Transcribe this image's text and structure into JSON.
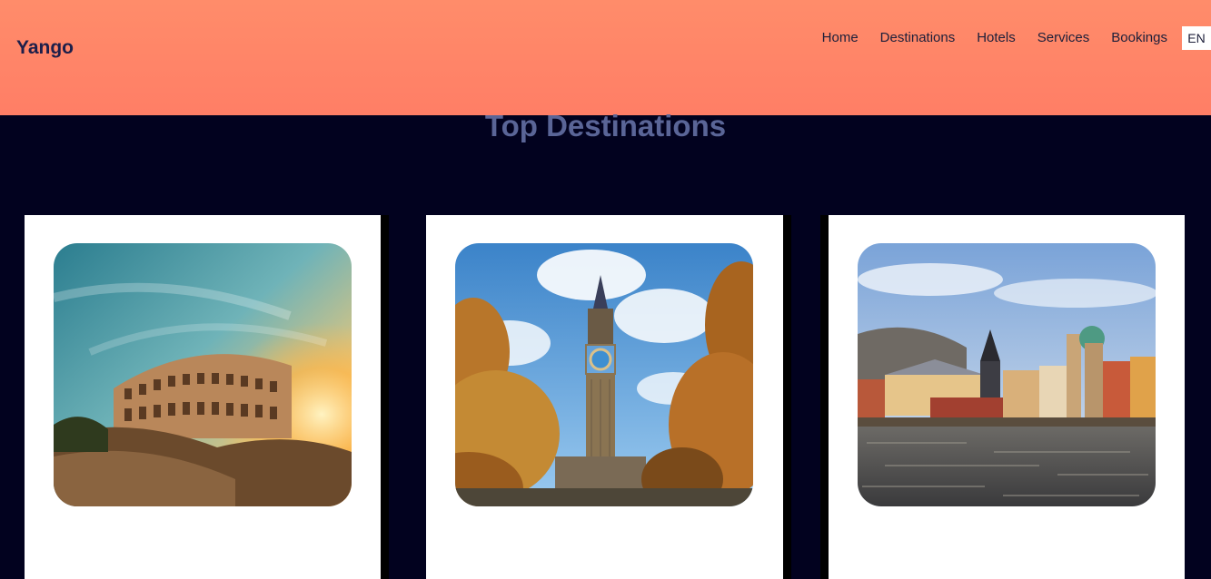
{
  "header": {
    "logo": "Yango",
    "nav": [
      "Home",
      "Destinations",
      "Hotels",
      "Services",
      "Bookings"
    ],
    "language": "EN"
  },
  "main": {
    "section_title": "Top Destinations",
    "cards": [
      {
        "image_icon": "colosseum-photo-icon"
      },
      {
        "image_icon": "big-ben-photo-icon"
      },
      {
        "image_icon": "prague-riverside-photo-icon"
      }
    ]
  },
  "colors": {
    "header_gradient_top": "#ff8c6a",
    "header_gradient_bottom": "#ff7e66",
    "page_background": "#02021f",
    "title_color": "#5a6597",
    "logo_color": "#1d1f4a"
  }
}
